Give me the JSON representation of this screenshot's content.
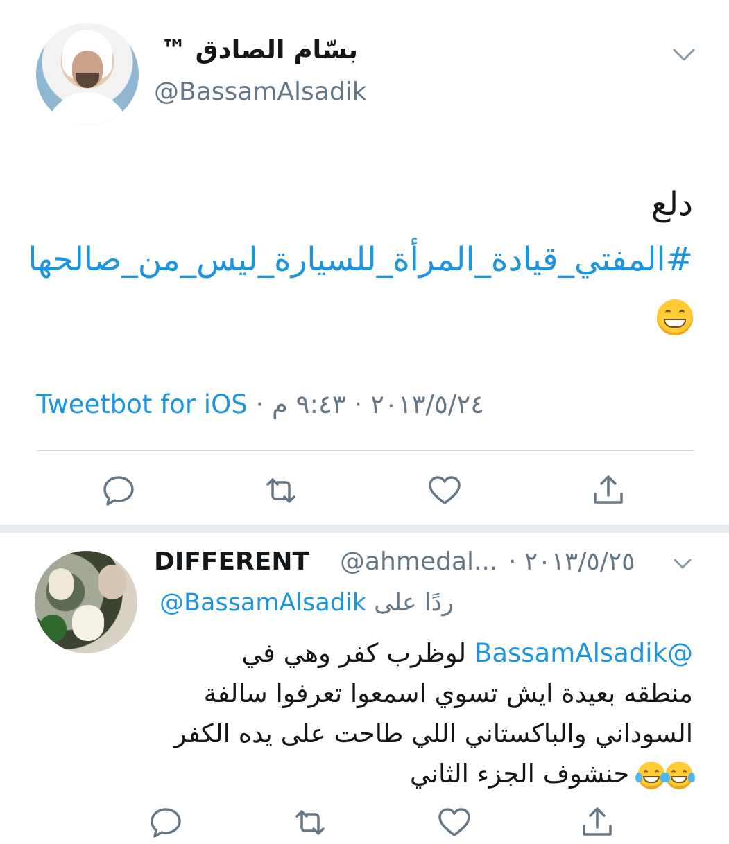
{
  "main_tweet": {
    "display_name": "بسّام الصادق ™",
    "handle": "@BassamAlsadik",
    "text_plain": "دلع",
    "hashtag": "#المفتي_قيادة_المرأة_للسيارة_ليس_من_صالحها",
    "emoji": "grinning-face",
    "meta": {
      "time": "٩:٤٣ م",
      "date": "٢٠١٣/٥/٢٤",
      "separator": " · ",
      "source": "Tweetbot for iOS"
    }
  },
  "reply_tweet": {
    "display_name": "DIFFERENT",
    "handle": "@ahmedal...",
    "date": "· ٢٠١٣/٥/٢٥",
    "replying_prefix": "ردًا على",
    "replying_to": "@BassamAlsadik",
    "mention": "@BassamAlsadik",
    "text": " لوظرب كفر وهي في منطقه بعيدة ايش تسوي  اسمعوا تعرفوا سالفة السوداني والباكستاني اللي طاحت على يده الكفر",
    "text_end": " حنشوف الجزء الثاني",
    "emoji": "face-with-tears-of-joy"
  },
  "actions": [
    "reply",
    "retweet",
    "like",
    "share"
  ],
  "colors": {
    "link": "#1b95e0",
    "secondary_text": "#657786",
    "divider": "#e6ecf0"
  }
}
